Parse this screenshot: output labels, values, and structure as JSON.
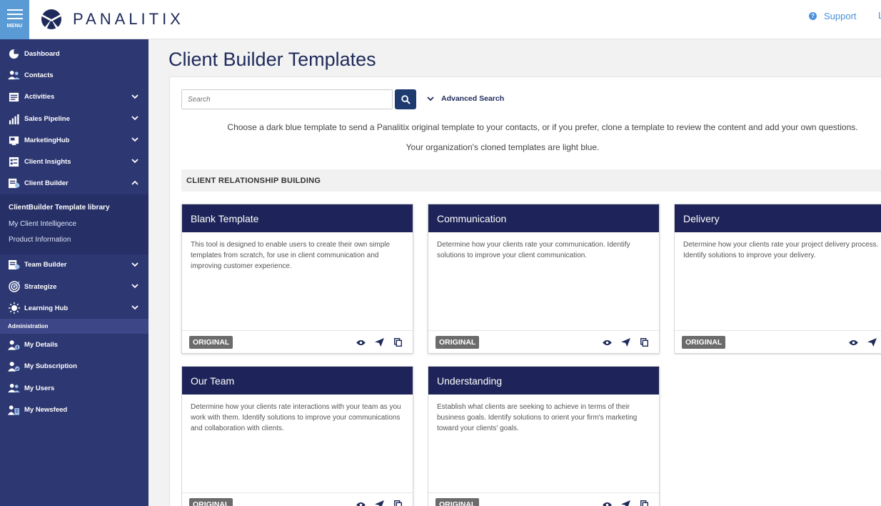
{
  "header": {
    "menu_label": "MENU",
    "logo_text": "PANALITIX",
    "support_label": "Support",
    "truncated_text": "L"
  },
  "sidebar": {
    "items": [
      {
        "label": "Dashboard",
        "icon": "dashboard-pie-icon"
      },
      {
        "label": "Contacts",
        "icon": "contacts-icon"
      },
      {
        "label": "Activities",
        "icon": "activities-icon"
      },
      {
        "label": "Sales Pipeline",
        "icon": "sales-pipeline-icon"
      },
      {
        "label": "MarketingHub",
        "icon": "marketinghub-icon"
      },
      {
        "label": "Client Insights",
        "icon": "client-insights-icon"
      },
      {
        "label": "Client Builder",
        "icon": "client-builder-icon"
      }
    ],
    "client_builder_sub": [
      {
        "label": "ClientBuilder Template library"
      },
      {
        "label": "My Client Intelligence"
      },
      {
        "label": "Product Information"
      }
    ],
    "items2": [
      {
        "label": "Team Builder",
        "icon": "team-builder-icon"
      },
      {
        "label": "Strategize",
        "icon": "strategize-target-icon"
      },
      {
        "label": "Learning Hub",
        "icon": "learning-hub-icon"
      }
    ],
    "admin_header": "Administration",
    "admin_items": [
      {
        "label": "My Details",
        "icon": "my-details-icon"
      },
      {
        "label": "My Subscription",
        "icon": "my-subscription-icon"
      },
      {
        "label": "My Users",
        "icon": "my-users-icon"
      },
      {
        "label": "My Newsfeed",
        "icon": "my-newsfeed-icon"
      }
    ]
  },
  "main": {
    "title": "Client Builder Templates",
    "search_placeholder": "Search",
    "advanced_search": "Advanced Search",
    "intro1": "Choose a dark blue template to send a Panalitix original template to your contacts, or if you prefer, clone a template to review the content and add your own questions.",
    "intro2": "Your organization's cloned templates are light blue.",
    "category": "CLIENT RELATIONSHIP BUILDING",
    "cards": [
      {
        "title": "Blank Template",
        "desc": "This tool is designed to enable users to create their own simple templates from scratch, for use in client communication and improving customer experience.",
        "badge": "ORIGINAL"
      },
      {
        "title": "Communication",
        "desc": "Determine how your clients rate your communication. Identify solutions to improve your client communication.",
        "badge": "ORIGINAL"
      },
      {
        "title": "Delivery",
        "desc": "Determine how your clients rate your project delivery process. Identify solutions to improve your delivery.",
        "badge": "ORIGINAL"
      },
      {
        "title": "Our Team",
        "desc": "Determine how your clients rate interactions with your team as you work with them. Identify solutions to improve your communications and collaboration with clients.",
        "badge": "ORIGINAL"
      },
      {
        "title": "Understanding",
        "desc": "Establish what clients are seeking to achieve in terms of their business goals. Identify solutions to orient your firm's marketing toward your clients' goals.",
        "badge": "ORIGINAL"
      }
    ]
  },
  "colors": {
    "sidebar": "#2d3771",
    "card_header": "#1e2459",
    "menu_button": "#5b9bd5",
    "support_link": "#4a90d9"
  }
}
